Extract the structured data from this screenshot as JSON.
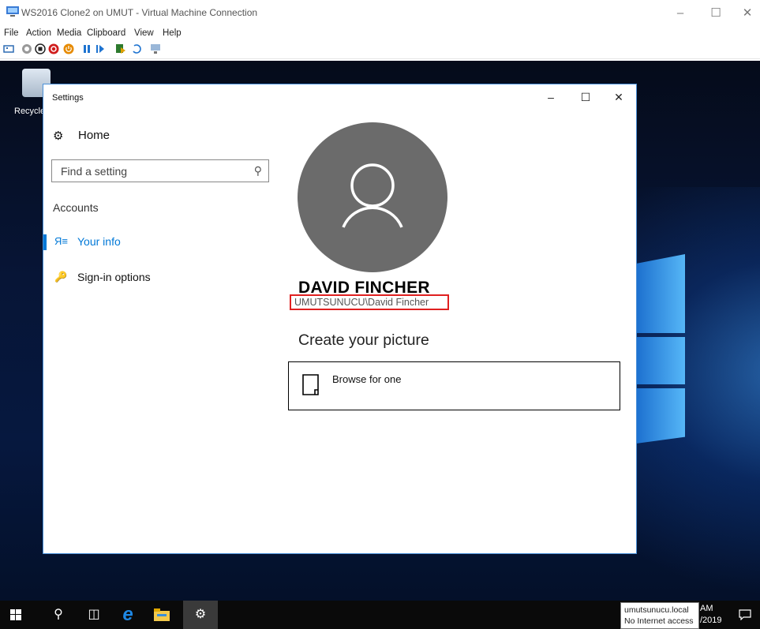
{
  "vm_window": {
    "title": "WS2016 Clone2 on UMUT - Virtual Machine Connection",
    "menu": [
      "File",
      "Action",
      "Media",
      "Clipboard",
      "View",
      "Help"
    ]
  },
  "desktop": {
    "recycle_bin_label": "Recycle"
  },
  "settings": {
    "title": "Settings",
    "nav": {
      "home_label": "Home",
      "search_placeholder": "Find a setting",
      "section_label": "Accounts",
      "items": [
        {
          "label": "Your info",
          "selected": true
        },
        {
          "label": "Sign-in options",
          "selected": false
        }
      ]
    },
    "content": {
      "user_name": "DAVID FINCHER",
      "account": "UMUTSUNUCU\\David Fincher",
      "create_picture_heading": "Create your picture",
      "browse_label": "Browse for one"
    }
  },
  "taskbar": {
    "network_popup": {
      "domain": "umutsunucu.local",
      "status": "No Internet access"
    },
    "clock_time": "AM",
    "clock_date": "/2019"
  },
  "colors": {
    "accent": "#0078d7",
    "highlight_border": "#e02020",
    "avatar_bg": "#6b6b6b"
  }
}
